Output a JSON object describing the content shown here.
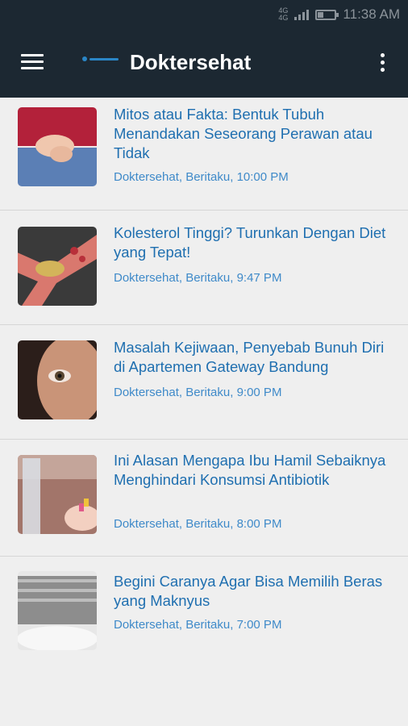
{
  "status_bar": {
    "network_top": "4G",
    "network_bottom": "4G",
    "time": "11:38 AM",
    "battery_level": 0.35
  },
  "app_bar": {
    "title": "Doktersehat",
    "menu_icon": "hamburger-menu-icon",
    "more_icon": "more-vert-icon"
  },
  "articles": [
    {
      "title": "Mitos atau Fakta: Bentuk Tubuh Menandakan Seseorang Perawan atau Tidak",
      "meta": "Doktersehat, Beritaku, 10:00 PM"
    },
    {
      "title": "Kolesterol Tinggi? Turunkan Dengan Diet yang Tepat!",
      "meta": "Doktersehat, Beritaku, 9:47 PM"
    },
    {
      "title": "Masalah Kejiwaan, Penyebab Bunuh Diri di Apartemen Gateway Bandung",
      "meta": "Doktersehat, Beritaku, 9:00 PM"
    },
    {
      "title": "Ini Alasan Mengapa Ibu Hamil Sebaiknya Menghindari Konsumsi Antibiotik",
      "meta": "Doktersehat, Beritaku, 8:00 PM"
    },
    {
      "title": "Begini Caranya Agar Bisa Memilih Beras yang Maknyus",
      "meta": "Doktersehat, Beritaku, 7:00 PM"
    }
  ]
}
